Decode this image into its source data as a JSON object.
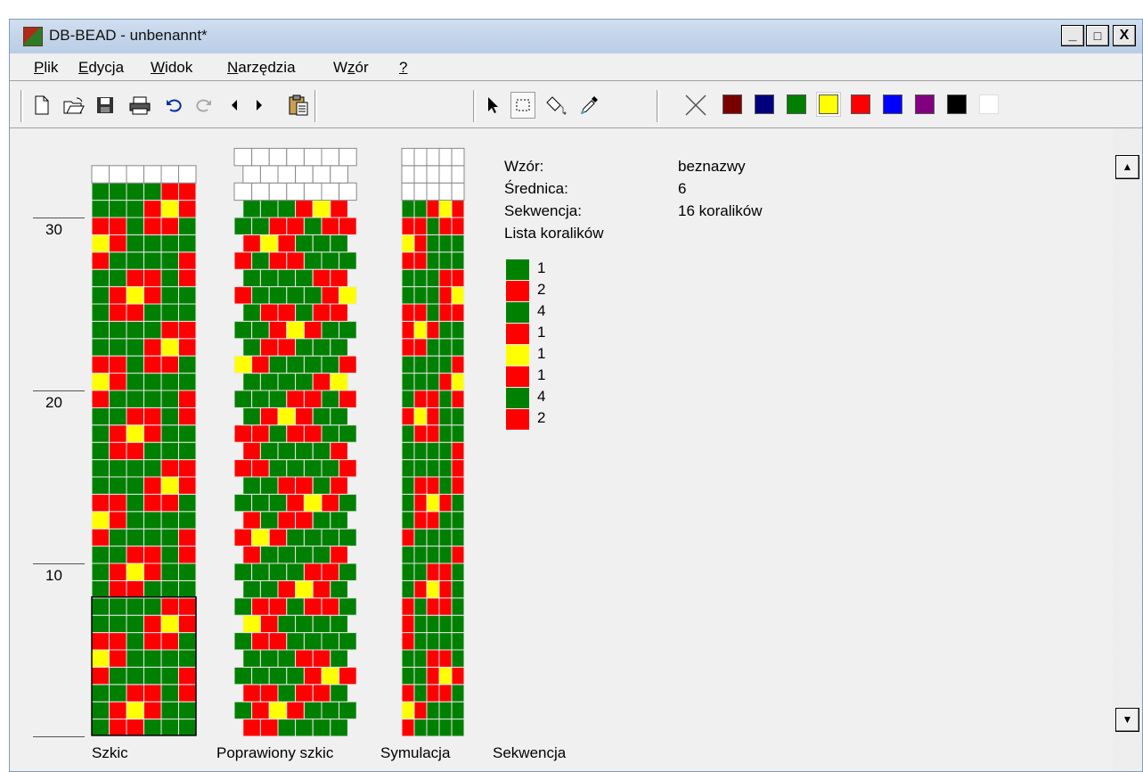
{
  "window": {
    "title": "DB-BEAD - unbenannt*",
    "minimize": "_",
    "maximize": "□",
    "close": "X"
  },
  "menu": [
    {
      "label": "Plik"
    },
    {
      "label": "Edycja"
    },
    {
      "label": "Widok"
    },
    {
      "label": "Narzędzia"
    },
    {
      "label": "Wzór"
    },
    {
      "label": "?"
    }
  ],
  "toolbar": {
    "buttons": [
      "new-file-icon",
      "open-folder-icon",
      "save-icon",
      "print-icon",
      "undo-icon",
      "redo-icon",
      "arrow-left-icon",
      "arrow-right-icon",
      "paste-icon",
      "pointer-icon",
      "select-rectangle-icon",
      "fill-icon",
      "eyedropper-icon"
    ],
    "palette": [
      "#7a0000",
      "#00007f",
      "#007f00",
      "#ffff00",
      "#ff0000",
      "#0000ff",
      "#800080",
      "#000000",
      "#ffffff"
    ],
    "selected_color_index": 3
  },
  "ruler": {
    "labels": [
      "30",
      "20",
      "10"
    ]
  },
  "info": {
    "wzor_label": "Wzór:",
    "wzor_value": "beznazwy",
    "srednica_label": "Średnica:",
    "srednica_value": "6",
    "sekwencja_label": "Sekwencja:",
    "sekwencja_value": "16 koralików",
    "lista_label": "Lista koralików"
  },
  "bead_list": [
    {
      "color": "#008000",
      "count": "1"
    },
    {
      "color": "#ff0000",
      "count": "2"
    },
    {
      "color": "#008000",
      "count": "4"
    },
    {
      "color": "#ff0000",
      "count": "1"
    },
    {
      "color": "#ffff00",
      "count": "1"
    },
    {
      "color": "#ff0000",
      "count": "1"
    },
    {
      "color": "#008000",
      "count": "4"
    },
    {
      "color": "#ff0000",
      "count": "2"
    }
  ],
  "column_labels": {
    "szkic": "Szkic",
    "poprawiony": "Poprawiony szkic",
    "symulacja": "Symulacja",
    "sekwencja": "Sekwencja"
  },
  "colors": {
    "green": "#008000",
    "red": "#ff0000",
    "yellow": "#ffff00"
  }
}
